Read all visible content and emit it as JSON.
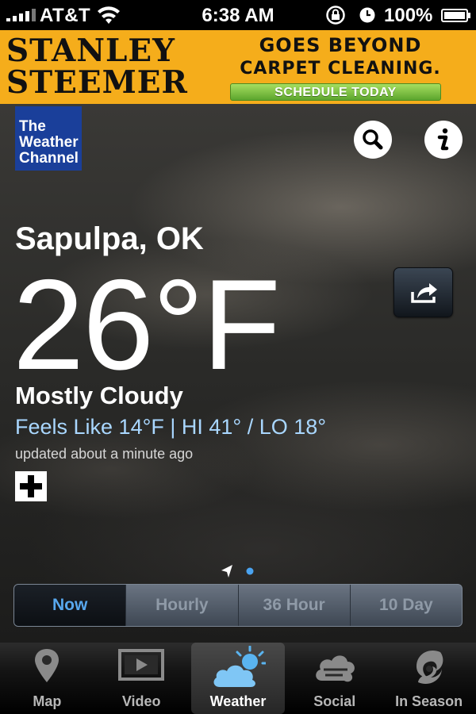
{
  "status_bar": {
    "carrier": "AT&T",
    "time": "6:38 AM",
    "battery": "100%"
  },
  "ad": {
    "brand_line1": "STANLEY",
    "brand_line2": "STEEMER",
    "headline_line1": "GOES BEYOND",
    "headline_line2": "CARPET CLEANING.",
    "cta": "SCHEDULE TODAY"
  },
  "logo": {
    "line1": "The",
    "line2": "Weather",
    "line3": "Channel"
  },
  "weather": {
    "location": "Sapulpa, OK",
    "temperature": "26°F",
    "condition": "Mostly Cloudy",
    "feels_like": "Feels Like 14°F | HI 41° / LO 18°",
    "updated": "updated about a minute ago"
  },
  "segments": {
    "now": "Now",
    "hourly": "Hourly",
    "thirty_six": "36 Hour",
    "ten_day": "10 Day",
    "active": "Now"
  },
  "tabs": {
    "map": "Map",
    "video": "Video",
    "weather": "Weather",
    "social": "Social",
    "in_season": "In Season",
    "active": "Weather"
  },
  "colors": {
    "ad_background": "#f5ad1b",
    "logo_blue": "#1a3f9a",
    "feels_like_text": "#a9d7ff",
    "active_segment_text": "#58a8ee"
  }
}
